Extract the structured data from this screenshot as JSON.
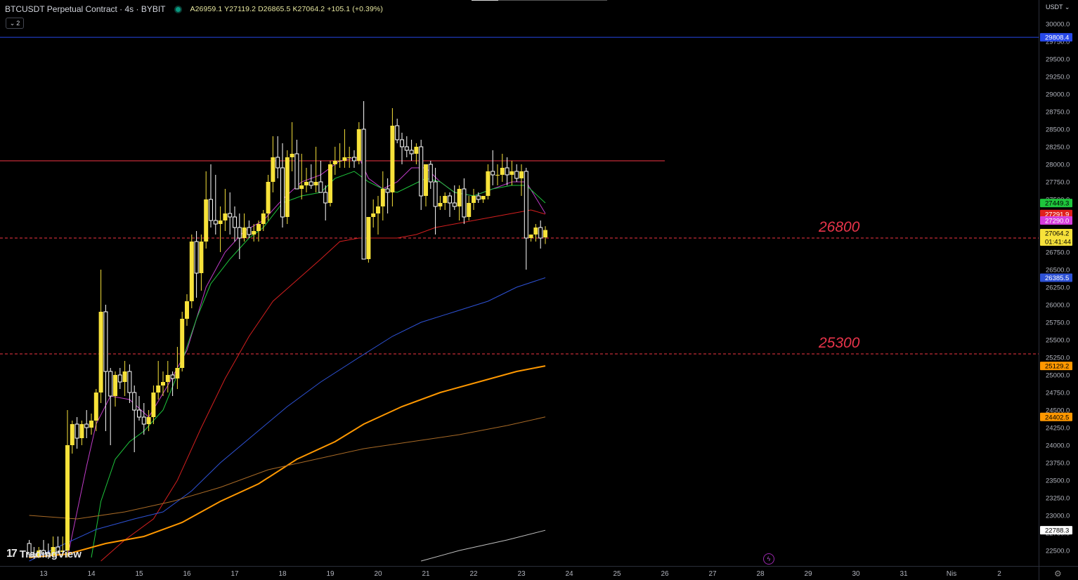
{
  "header": {
    "symbol": "BTCUSDT Perpetual Contract · 4s · BYBIT",
    "ohlc": "A26959.1  Y27119.2  D26865.5  K27064.2  +105.1 (+0.39%)",
    "indicator_count": "2"
  },
  "currency_menu": "USDT",
  "brand": "TradingView",
  "icons": {
    "collapse": "chevron-down-icon",
    "bolt": "lightning-icon",
    "settings": "gear-icon"
  },
  "colors": {
    "bull": "#f7e23a",
    "bear": "#ffffff",
    "ema_magenta": "#c03cc8",
    "ema_green": "#1ec53c",
    "ema_red": "#d41f1f",
    "ema_blue": "#2e52d6",
    "ema_orange": "#ff9800",
    "ema_brown": "#a86a26",
    "ema_white": "#bfbfbf",
    "hline_blue": "#2748e8",
    "hline_red": "#f23645",
    "annotation": "#e8344a"
  },
  "chart_data": {
    "type": "candlestick",
    "ylim": [
      22350,
      30250
    ],
    "x_labels": [
      "13",
      "14",
      "15",
      "16",
      "17",
      "18",
      "19",
      "20",
      "21",
      "22",
      "23",
      "24",
      "25",
      "26",
      "27",
      "28",
      "29",
      "30",
      "31",
      "Nis",
      "2"
    ],
    "y_ticks": [
      30000,
      29750,
      29500,
      29250,
      29000,
      28750,
      28500,
      28250,
      28000,
      27750,
      27500,
      27250,
      27000,
      26750,
      26500,
      26250,
      26000,
      25750,
      25500,
      25250,
      25000,
      24750,
      24500,
      24250,
      24000,
      23750,
      23500,
      23250,
      23000,
      22750,
      22500
    ],
    "candles_ohlc": [
      [
        22600,
        22650,
        22400,
        22450
      ],
      [
        22450,
        22550,
        22380,
        22420
      ],
      [
        22420,
        22550,
        22390,
        22500
      ],
      [
        22500,
        22650,
        22400,
        22450
      ],
      [
        22450,
        22600,
        22380,
        22430
      ],
      [
        22430,
        22700,
        22400,
        22550
      ],
      [
        22550,
        22700,
        22450,
        22480
      ],
      [
        22480,
        22700,
        22420,
        22500
      ],
      [
        22500,
        24500,
        22400,
        24000
      ],
      [
        24000,
        24350,
        23880,
        24300
      ],
      [
        24300,
        24400,
        23950,
        24100
      ],
      [
        24100,
        24350,
        24000,
        24300
      ],
      [
        24300,
        24500,
        24100,
        24250
      ],
      [
        24250,
        24450,
        24150,
        24350
      ],
      [
        24350,
        24800,
        24200,
        24750
      ],
      [
        24750,
        26500,
        24600,
        25900
      ],
      [
        25900,
        26000,
        24200,
        25050
      ],
      [
        25050,
        25100,
        24000,
        24700
      ],
      [
        24700,
        25050,
        24550,
        25000
      ],
      [
        25000,
        25100,
        24800,
        24900
      ],
      [
        24900,
        25200,
        24700,
        25050
      ],
      [
        25050,
        25150,
        24600,
        24750
      ],
      [
        24750,
        24850,
        23900,
        24500
      ],
      [
        24500,
        24700,
        24350,
        24400
      ],
      [
        24400,
        24600,
        24150,
        24300
      ],
      [
        24300,
        24500,
        24200,
        24400
      ],
      [
        24400,
        24850,
        24300,
        24750
      ],
      [
        24750,
        25200,
        24650,
        24850
      ],
      [
        24850,
        25050,
        24700,
        24900
      ],
      [
        24900,
        25200,
        24750,
        25000
      ],
      [
        25000,
        25050,
        24700,
        24950
      ],
      [
        24950,
        25400,
        24800,
        25100
      ],
      [
        25100,
        25900,
        25050,
        25800
      ],
      [
        25800,
        26150,
        25700,
        26050
      ],
      [
        26050,
        27000,
        25950,
        26900
      ],
      [
        26900,
        27050,
        26100,
        26450
      ],
      [
        26450,
        27000,
        26200,
        26900
      ],
      [
        26900,
        27900,
        26800,
        27500
      ],
      [
        27500,
        28000,
        27100,
        27200
      ],
      [
        27200,
        27850,
        27000,
        27150
      ],
      [
        27150,
        27400,
        26750,
        27200
      ],
      [
        27200,
        27650,
        27050,
        27300
      ],
      [
        27300,
        27600,
        27000,
        27250
      ],
      [
        27250,
        27400,
        26900,
        27100
      ],
      [
        27100,
        27300,
        26650,
        26950
      ],
      [
        26950,
        27300,
        26900,
        27100
      ],
      [
        27100,
        27200,
        26950,
        27000
      ],
      [
        27000,
        27150,
        26900,
        27050
      ],
      [
        27050,
        27200,
        26900,
        27150
      ],
      [
        27150,
        27350,
        27050,
        27300
      ],
      [
        27300,
        27850,
        27200,
        27750
      ],
      [
        27750,
        28400,
        27600,
        28100
      ],
      [
        28100,
        28400,
        27800,
        27950
      ],
      [
        27950,
        28300,
        27100,
        27250
      ],
      [
        27250,
        28200,
        27150,
        28100
      ],
      [
        28100,
        28600,
        27900,
        28150
      ],
      [
        28150,
        28350,
        27700,
        27650
      ],
      [
        27650,
        28150,
        27500,
        27700
      ],
      [
        27700,
        27950,
        27600,
        27750
      ],
      [
        27750,
        28000,
        27650,
        27700
      ],
      [
        27700,
        28250,
        27600,
        27750
      ],
      [
        27750,
        28050,
        27650,
        27600
      ],
      [
        27600,
        27700,
        27200,
        27450
      ],
      [
        27450,
        28050,
        27400,
        28000
      ],
      [
        28000,
        28250,
        27850,
        28050
      ],
      [
        28050,
        28300,
        27950,
        28050
      ],
      [
        28050,
        28500,
        27950,
        28100
      ],
      [
        28100,
        28250,
        27950,
        28100
      ],
      [
        28100,
        28200,
        27950,
        28050
      ],
      [
        28050,
        28600,
        28000,
        28500
      ],
      [
        28500,
        28900,
        26650,
        26650
      ],
      [
        26650,
        26800,
        26600,
        27250
      ],
      [
        27250,
        27500,
        27100,
        27300
      ],
      [
        27300,
        27550,
        27000,
        27400
      ],
      [
        27400,
        27900,
        27200,
        27650
      ],
      [
        27650,
        27800,
        27300,
        27600
      ],
      [
        27600,
        28800,
        27400,
        28550
      ],
      [
        28550,
        28650,
        28300,
        28350
      ],
      [
        28350,
        28450,
        28000,
        28250
      ],
      [
        28250,
        28400,
        28100,
        28200
      ],
      [
        28200,
        28350,
        28050,
        28150
      ],
      [
        28150,
        28300,
        28000,
        28250
      ],
      [
        28250,
        28350,
        27350,
        27550
      ],
      [
        27550,
        28000,
        27400,
        28000
      ],
      [
        28000,
        28050,
        27650,
        27750
      ],
      [
        27750,
        27950,
        27000,
        27400
      ],
      [
        27400,
        27550,
        27350,
        27450
      ],
      [
        27450,
        27600,
        27350,
        27550
      ],
      [
        27550,
        27600,
        27250,
        27450
      ],
      [
        27450,
        27700,
        27350,
        27400
      ],
      [
        27400,
        27700,
        27200,
        27650
      ],
      [
        27650,
        27800,
        27150,
        27250
      ],
      [
        27250,
        27550,
        27200,
        27450
      ],
      [
        27450,
        27650,
        27350,
        27550
      ],
      [
        27550,
        27600,
        27450,
        27500
      ],
      [
        27500,
        27550,
        27450,
        27550
      ],
      [
        27550,
        28000,
        27500,
        27900
      ],
      [
        27900,
        28200,
        27700,
        27850
      ],
      [
        27850,
        28000,
        27700,
        27850
      ],
      [
        27850,
        28150,
        27750,
        27950
      ],
      [
        27950,
        28100,
        27700,
        27850
      ],
      [
        27850,
        28050,
        27700,
        27900
      ],
      [
        27900,
        28000,
        27750,
        27800
      ],
      [
        27800,
        28000,
        27550,
        27900
      ],
      [
        27900,
        27950,
        26500,
        26950
      ],
      [
        26950,
        27000,
        26900,
        27000
      ],
      [
        27000,
        27150,
        26900,
        27100
      ],
      [
        27100,
        27200,
        26800,
        26950
      ],
      [
        26959.1,
        27119.2,
        26865.5,
        27064.2
      ]
    ],
    "moving_averages": [
      {
        "color": "#c03cc8",
        "width": 1,
        "points": [
          [
            8,
            22400
          ],
          [
            12,
            23700
          ],
          [
            14,
            24300
          ],
          [
            17,
            24700
          ],
          [
            21,
            24650
          ],
          [
            25,
            24400
          ],
          [
            29,
            24850
          ],
          [
            33,
            25350
          ],
          [
            37,
            26250
          ],
          [
            41,
            26750
          ],
          [
            45,
            27050
          ],
          [
            49,
            27200
          ],
          [
            53,
            27500
          ],
          [
            57,
            27750
          ],
          [
            61,
            27850
          ],
          [
            65,
            28050
          ],
          [
            69,
            28100
          ],
          [
            71,
            27800
          ],
          [
            74,
            27650
          ],
          [
            77,
            27750
          ],
          [
            80,
            27950
          ],
          [
            83,
            27950
          ],
          [
            86,
            27750
          ],
          [
            89,
            27600
          ],
          [
            93,
            27550
          ],
          [
            97,
            27650
          ],
          [
            101,
            27750
          ],
          [
            104,
            27750
          ],
          [
            108,
            27300
          ]
        ]
      },
      {
        "color": "#1ec53c",
        "width": 1,
        "points": [
          [
            13,
            22400
          ],
          [
            15,
            23200
          ],
          [
            18,
            23800
          ],
          [
            21,
            24050
          ],
          [
            24,
            24200
          ],
          [
            28,
            24500
          ],
          [
            31,
            25000
          ],
          [
            35,
            25800
          ],
          [
            38,
            26300
          ],
          [
            42,
            26650
          ],
          [
            46,
            26950
          ],
          [
            49,
            27100
          ],
          [
            53,
            27450
          ],
          [
            57,
            27550
          ],
          [
            61,
            27600
          ],
          [
            64,
            27800
          ],
          [
            68,
            27900
          ],
          [
            71,
            27750
          ],
          [
            74,
            27650
          ],
          [
            77,
            27600
          ],
          [
            80,
            27700
          ],
          [
            83,
            27800
          ],
          [
            86,
            27750
          ],
          [
            89,
            27600
          ],
          [
            93,
            27550
          ],
          [
            97,
            27650
          ],
          [
            101,
            27700
          ],
          [
            104,
            27700
          ],
          [
            108,
            27450
          ]
        ]
      },
      {
        "color": "#d41f1f",
        "width": 1,
        "points": [
          [
            15,
            22350
          ],
          [
            20,
            22650
          ],
          [
            26,
            22950
          ],
          [
            31,
            23500
          ],
          [
            36,
            24250
          ],
          [
            41,
            24950
          ],
          [
            46,
            25550
          ],
          [
            51,
            26050
          ],
          [
            56,
            26350
          ],
          [
            61,
            26650
          ],
          [
            65,
            26900
          ],
          [
            69,
            26950
          ],
          [
            73,
            26950
          ],
          [
            77,
            26950
          ],
          [
            81,
            27000
          ],
          [
            85,
            27100
          ],
          [
            89,
            27150
          ],
          [
            93,
            27200
          ],
          [
            97,
            27250
          ],
          [
            101,
            27300
          ],
          [
            105,
            27350
          ],
          [
            108,
            27290
          ]
        ]
      },
      {
        "color": "#2e52d6",
        "width": 1,
        "points": [
          [
            0,
            22350
          ],
          [
            6,
            22550
          ],
          [
            14,
            22800
          ],
          [
            22,
            22950
          ],
          [
            28,
            23050
          ],
          [
            34,
            23350
          ],
          [
            40,
            23750
          ],
          [
            47,
            24150
          ],
          [
            54,
            24550
          ],
          [
            61,
            24900
          ],
          [
            69,
            25250
          ],
          [
            76,
            25550
          ],
          [
            82,
            25750
          ],
          [
            89,
            25900
          ],
          [
            96,
            26050
          ],
          [
            102,
            26250
          ],
          [
            108,
            26385.5
          ]
        ]
      },
      {
        "color": "#ff9800",
        "width": 2,
        "points": [
          [
            0,
            22400
          ],
          [
            8,
            22450
          ],
          [
            16,
            22600
          ],
          [
            24,
            22700
          ],
          [
            32,
            22900
          ],
          [
            40,
            23200
          ],
          [
            48,
            23450
          ],
          [
            56,
            23800
          ],
          [
            64,
            24050
          ],
          [
            70,
            24300
          ],
          [
            78,
            24550
          ],
          [
            86,
            24750
          ],
          [
            94,
            24900
          ],
          [
            102,
            25050
          ],
          [
            108,
            25129.2
          ]
        ]
      },
      {
        "color": "#a86a26",
        "width": 1,
        "points": [
          [
            0,
            23000
          ],
          [
            10,
            22950
          ],
          [
            20,
            23050
          ],
          [
            30,
            23200
          ],
          [
            40,
            23400
          ],
          [
            50,
            23650
          ],
          [
            60,
            23800
          ],
          [
            70,
            23950
          ],
          [
            80,
            24050
          ],
          [
            90,
            24150
          ],
          [
            100,
            24280
          ],
          [
            108,
            24402.5
          ]
        ]
      },
      {
        "color": "#bfbfbf",
        "width": 1,
        "points": [
          [
            82,
            22350
          ],
          [
            90,
            22500
          ],
          [
            100,
            22650
          ],
          [
            108,
            22788.3
          ]
        ]
      }
    ],
    "horizontal_lines": [
      {
        "value": 29808.4,
        "color": "#2748e8",
        "style": "solid",
        "full_width": true
      },
      {
        "value": 28050,
        "color": "#f23645",
        "style": "solid",
        "full_width": false
      },
      {
        "value": 26950,
        "color": "#f23645",
        "style": "dashed",
        "full_width": true
      },
      {
        "value": 25300,
        "color": "#f23645",
        "style": "dashed",
        "full_width": true
      }
    ],
    "annotations": [
      {
        "text": "26800",
        "value": 26950
      },
      {
        "text": "25300",
        "value": 25300
      }
    ],
    "price_labels": [
      {
        "text": "29808.4",
        "value": 29808.4,
        "bg": "#2748e8",
        "fg": "#ffffff"
      },
      {
        "text": "27449.3",
        "value": 27449.3,
        "bg": "#1ec53c",
        "fg": "#000000"
      },
      {
        "text": "27291.9",
        "value": 27291.9,
        "bg": "#e0201e",
        "fg": "#ffffff"
      },
      {
        "text": "27290.0",
        "value": 27200,
        "bg": "#d63cdc",
        "fg": "#ffffff"
      },
      {
        "text": "27064.2",
        "text2": "01:41:44",
        "value": 27020,
        "bg": "#f7e23a",
        "fg": "#000000"
      },
      {
        "text": "26385.5",
        "value": 26385.5,
        "bg": "#2e52d6",
        "fg": "#ffffff"
      },
      {
        "text": "25129.2",
        "value": 25129.2,
        "bg": "#ff9800",
        "fg": "#000000"
      },
      {
        "text": "24402.5",
        "value": 24402.5,
        "bg": "#ff9800",
        "fg": "#000000"
      },
      {
        "text": "22788.3",
        "value": 22788.3,
        "bg": "#ffffff",
        "fg": "#000000"
      }
    ]
  }
}
